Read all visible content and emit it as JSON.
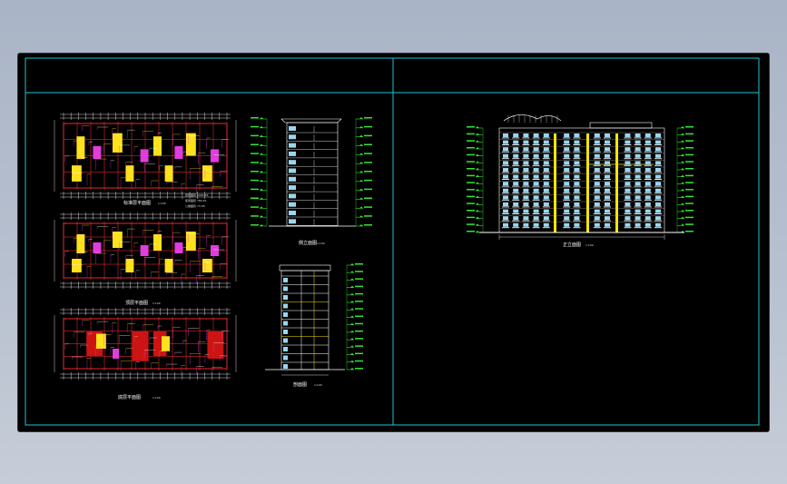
{
  "app": {
    "title": "",
    "viewport_background": "#000000",
    "colors": {
      "frame": "#19c9d6",
      "dimension": "#ffffff",
      "wall": "#ff3030",
      "level_mark": "#32e632",
      "fill_red": "#cc1414",
      "fill_yellow": "#ffe11e",
      "fill_magenta": "#e13cdc",
      "window_blue": "#9ad6ee",
      "grid_yellow": "#f5e600"
    }
  },
  "drawing": {
    "plans": [
      {
        "name": "standard-floor-plan",
        "title": "标准层平面图",
        "scale": "1:100",
        "notes": [
          "建筑面积 1000.46",
          "使用面积 780.45",
          "公摊面积 73.58"
        ]
      },
      {
        "name": "top-floor-plan",
        "title": "顶层平面图",
        "scale": "1:100",
        "notes": []
      },
      {
        "name": "ground-floor-plan",
        "title": "底层平面图",
        "scale": "1:100",
        "notes": []
      }
    ],
    "side_elevation": {
      "title": "侧立面图",
      "scale": "1:100"
    },
    "section": {
      "title": "剖面图",
      "scale": "1:100"
    },
    "front_elevation": {
      "title": "正立面图",
      "scale": "1:100"
    }
  }
}
